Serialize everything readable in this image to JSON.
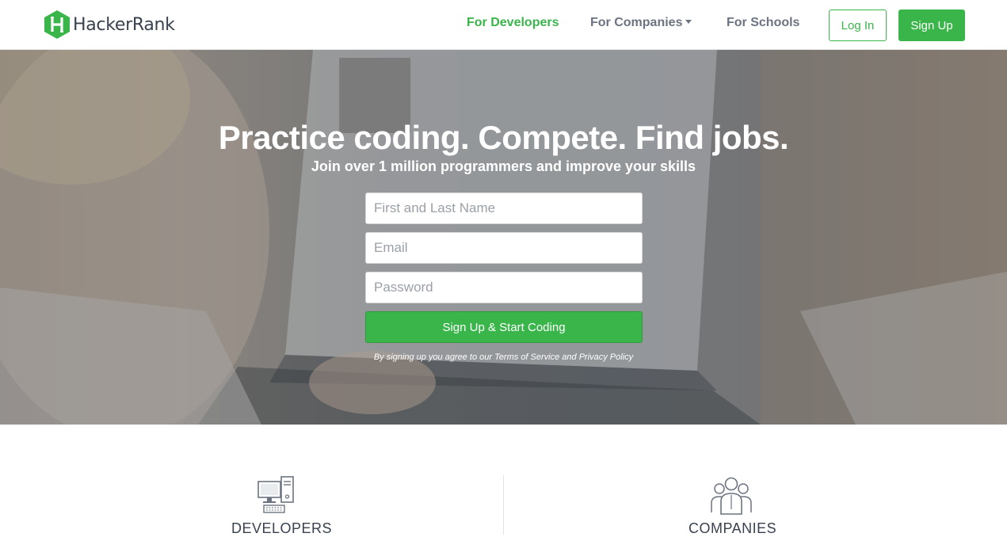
{
  "header": {
    "logo_text": "HackerRank",
    "logo_icon": "hackerrank-hexagon-icon",
    "nav": {
      "developers": "For Developers",
      "companies": "For Companies",
      "schools": "For Schools"
    },
    "login_label": "Log In",
    "signup_label": "Sign Up"
  },
  "hero": {
    "title": "Practice coding. Compete. Find jobs.",
    "subtitle": "Join over 1 million programmers and improve your skills",
    "form": {
      "name_placeholder": "First and Last Name",
      "email_placeholder": "Email",
      "password_placeholder": "Password",
      "submit_label": "Sign Up & Start Coding",
      "terms_text": "By signing up you agree to our Terms of Service and Privacy Policy"
    }
  },
  "sections": {
    "developers": {
      "label": "DEVELOPERS",
      "icon": "computer-icon"
    },
    "companies": {
      "label": "COMPANIES",
      "icon": "people-group-icon"
    }
  },
  "colors": {
    "brand_green": "#39b54a",
    "text_dark": "#39424e",
    "nav_gray": "#6b7480"
  }
}
